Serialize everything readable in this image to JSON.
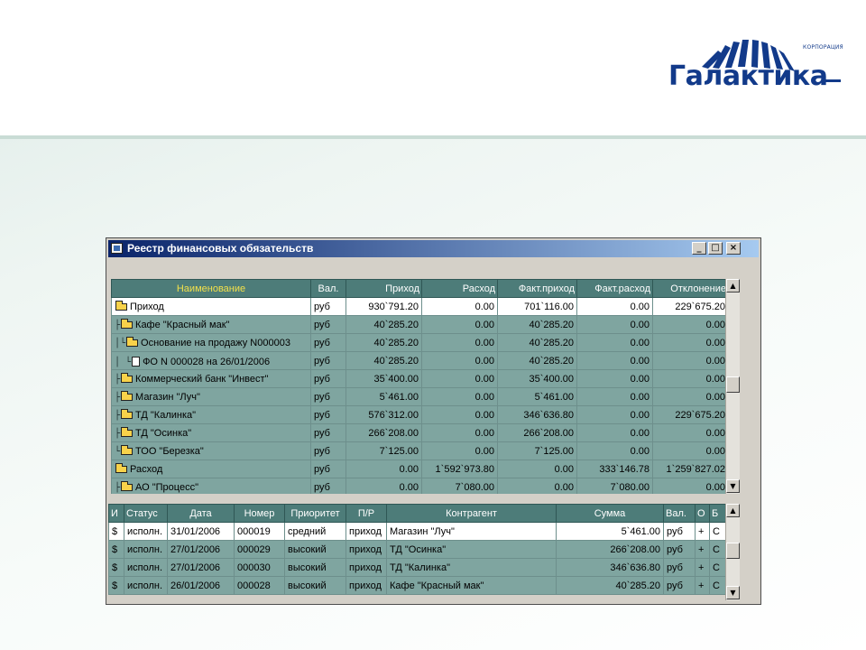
{
  "logo": {
    "subtitle": "КОРПОРАЦИЯ",
    "name": "Галактика"
  },
  "window": {
    "title": "Реестр финансовых обязательств",
    "buttons": {
      "minimize": "_",
      "maximize": "□",
      "close": "×"
    }
  },
  "register_table": {
    "columns": [
      "Наименование",
      "Вал.",
      "Приход",
      "Расход",
      "Факт.приход",
      "Факт.расход",
      "Отклонение"
    ],
    "rows": [
      {
        "tree": "",
        "icon": "folder",
        "name": "Приход",
        "currency": "руб",
        "income": "930`791.20",
        "expense": "0.00",
        "fact_income": "701`116.00",
        "fact_expense": "0.00",
        "deviation": "229`675.20"
      },
      {
        "tree": "├",
        "icon": "folder",
        "name": "Кафе \"Красный мак\"",
        "currency": "руб",
        "income": "40`285.20",
        "expense": "0.00",
        "fact_income": "40`285.20",
        "fact_expense": "0.00",
        "deviation": "0.00"
      },
      {
        "tree": "│└",
        "icon": "folder",
        "name": "Основание на продажу N000003",
        "currency": "руб",
        "income": "40`285.20",
        "expense": "0.00",
        "fact_income": "40`285.20",
        "fact_expense": "0.00",
        "deviation": "0.00"
      },
      {
        "tree": "│ └",
        "icon": "doc",
        "name": "ФО N 000028 на 26/01/2006",
        "currency": "руб",
        "income": "40`285.20",
        "expense": "0.00",
        "fact_income": "40`285.20",
        "fact_expense": "0.00",
        "deviation": "0.00"
      },
      {
        "tree": "├",
        "icon": "folder",
        "name": "Коммерческий банк \"Инвест\"",
        "currency": "руб",
        "income": "35`400.00",
        "expense": "0.00",
        "fact_income": "35`400.00",
        "fact_expense": "0.00",
        "deviation": "0.00"
      },
      {
        "tree": "├",
        "icon": "folder",
        "name": "Магазин \"Луч\"",
        "currency": "руб",
        "income": "5`461.00",
        "expense": "0.00",
        "fact_income": "5`461.00",
        "fact_expense": "0.00",
        "deviation": "0.00"
      },
      {
        "tree": "├",
        "icon": "folder",
        "name": "ТД \"Калинка\"",
        "currency": "руб",
        "income": "576`312.00",
        "expense": "0.00",
        "fact_income": "346`636.80",
        "fact_expense": "0.00",
        "deviation": "229`675.20"
      },
      {
        "tree": "├",
        "icon": "folder",
        "name": "ТД \"Осинка\"",
        "currency": "руб",
        "income": "266`208.00",
        "expense": "0.00",
        "fact_income": "266`208.00",
        "fact_expense": "0.00",
        "deviation": "0.00"
      },
      {
        "tree": "└",
        "icon": "folder",
        "name": "ТОО \"Березка\"",
        "currency": "руб",
        "income": "7`125.00",
        "expense": "0.00",
        "fact_income": "7`125.00",
        "fact_expense": "0.00",
        "deviation": "0.00"
      },
      {
        "tree": "",
        "icon": "folder",
        "name": "Расход",
        "currency": "руб",
        "income": "0.00",
        "expense": "1`592`973.80",
        "fact_income": "0.00",
        "fact_expense": "333`146.78",
        "deviation": "1`259`827.02"
      },
      {
        "tree": "├",
        "icon": "folder",
        "name": "АО \"Процесс\"",
        "currency": "руб",
        "income": "0.00",
        "expense": "7`080.00",
        "fact_income": "0.00",
        "fact_expense": "7`080.00",
        "deviation": "0.00"
      }
    ]
  },
  "documents_table": {
    "columns": [
      "И",
      "Статус",
      "Дата",
      "Номер",
      "Приоритет",
      "П/Р",
      "Контрагент",
      "Сумма",
      "Вал.",
      "О",
      "Б"
    ],
    "rows": [
      {
        "i": "$",
        "status": "исполн.",
        "date": "31/01/2006",
        "number": "000019",
        "priority": "средний",
        "pr": "приход",
        "counterparty": "Магазин \"Луч\"",
        "amount": "5`461.00",
        "currency": "руб",
        "o": "+",
        "b": "С"
      },
      {
        "i": "$",
        "status": "исполн.",
        "date": "27/01/2006",
        "number": "000029",
        "priority": "высокий",
        "pr": "приход",
        "counterparty": "ТД \"Осинка\"",
        "amount": "266`208.00",
        "currency": "руб",
        "o": "+",
        "b": "С"
      },
      {
        "i": "$",
        "status": "исполн.",
        "date": "27/01/2006",
        "number": "000030",
        "priority": "высокий",
        "pr": "приход",
        "counterparty": "ТД \"Калинка\"",
        "amount": "346`636.80",
        "currency": "руб",
        "o": "+",
        "b": "С"
      },
      {
        "i": "$",
        "status": "исполн.",
        "date": "26/01/2006",
        "number": "000028",
        "priority": "высокий",
        "pr": "приход",
        "counterparty": "Кафе \"Красный мак\"",
        "amount": "40`285.20",
        "currency": "руб",
        "o": "+",
        "b": "С"
      }
    ]
  },
  "scroll": {
    "up": "▲",
    "down": "▼"
  },
  "colors": {
    "grid_bg": "#7fa5a0",
    "header_bg": "#4d7c79",
    "header_name": "#f2e04a",
    "title_from": "#0a246a",
    "title_to": "#a6caf0"
  }
}
